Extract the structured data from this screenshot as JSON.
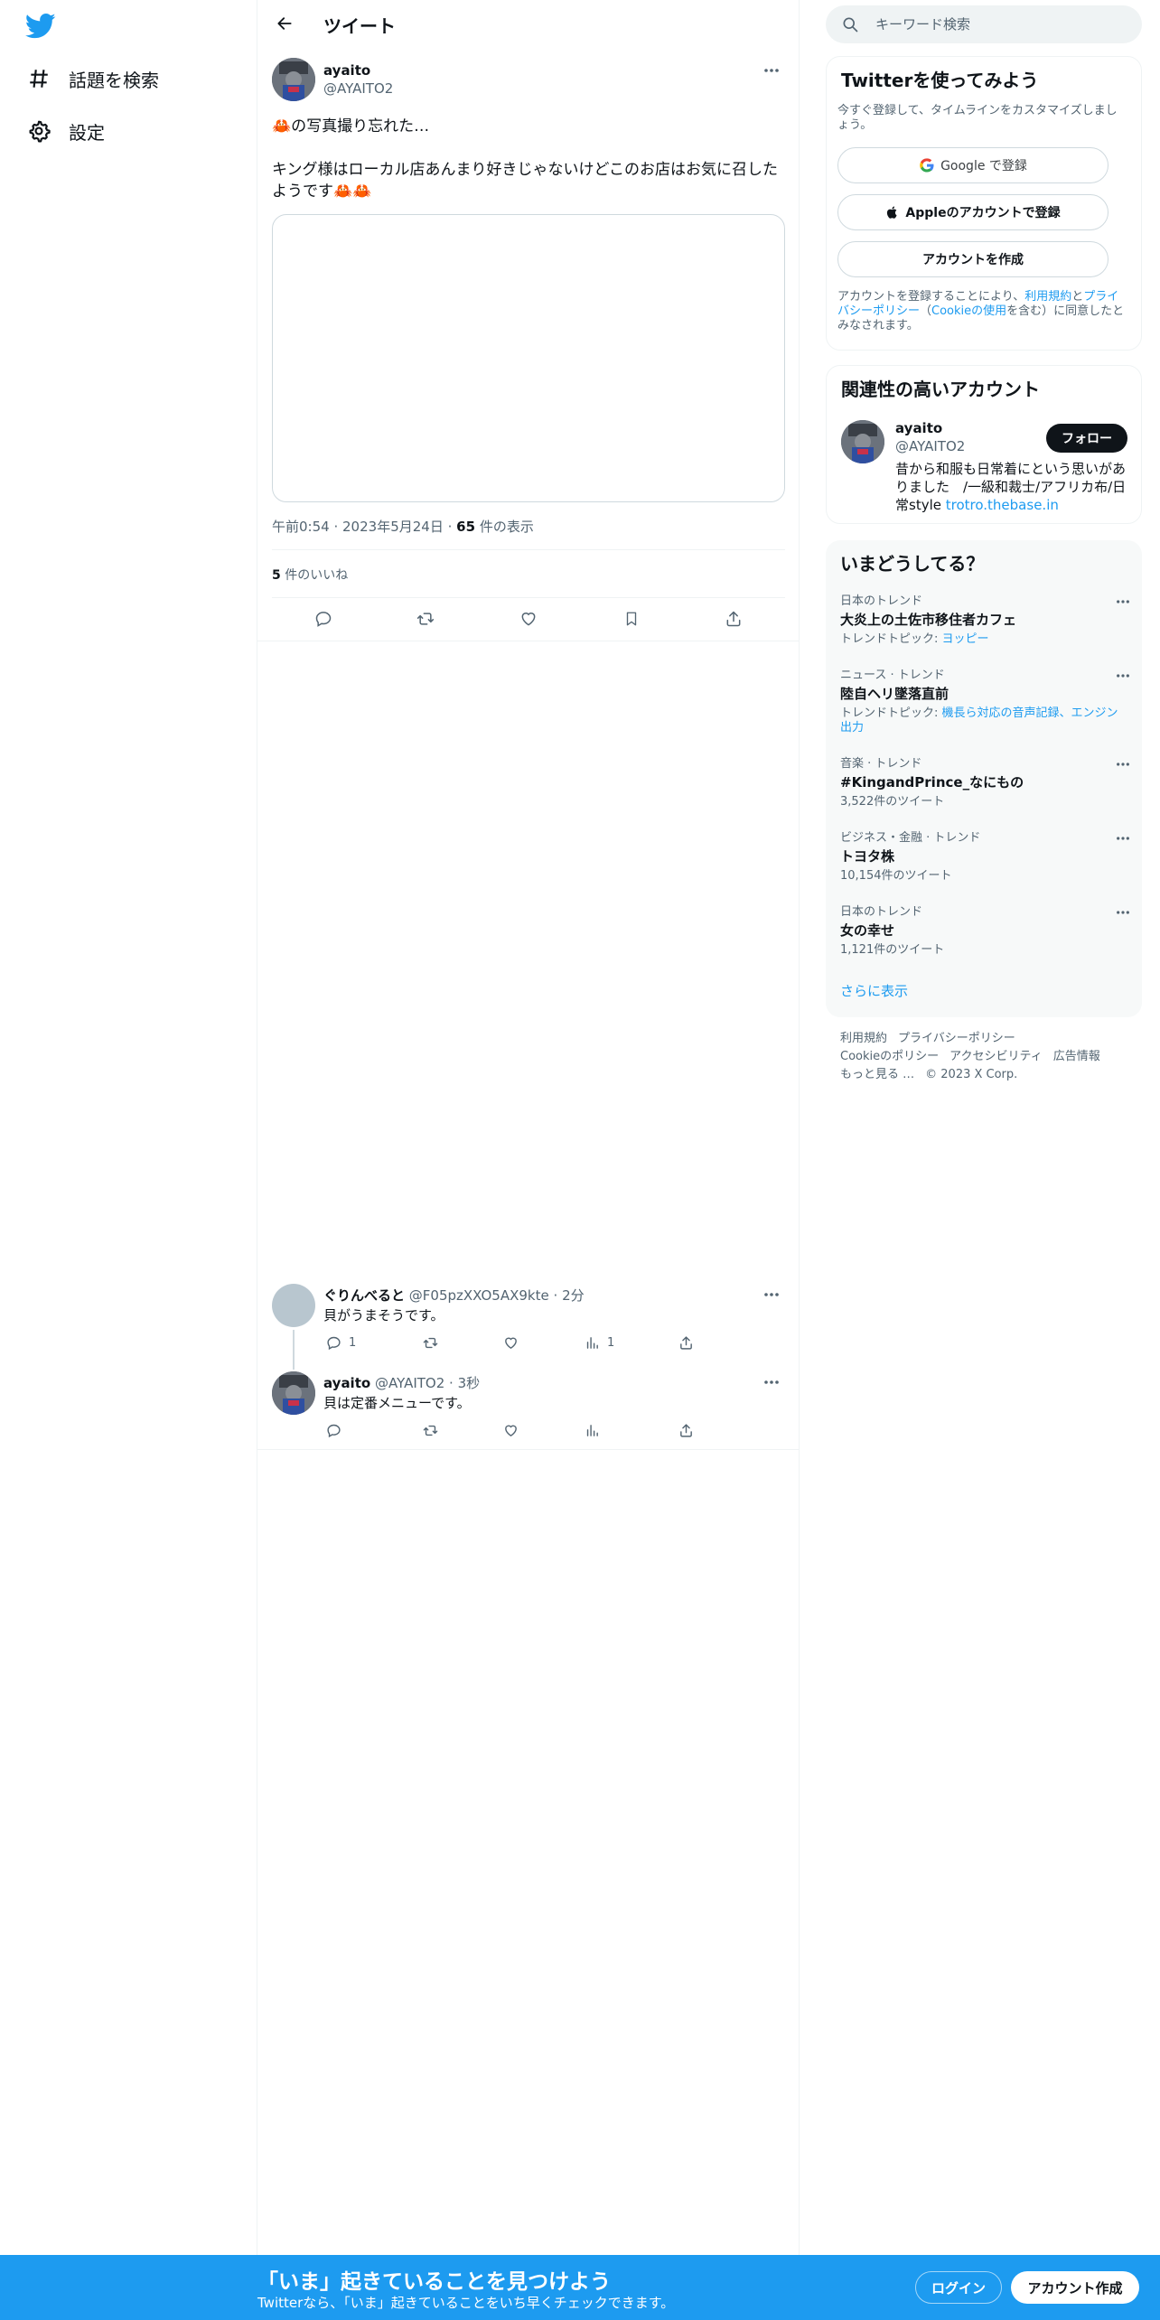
{
  "nav": {
    "items": [
      {
        "label": "話題を検索",
        "icon": "hashtag-icon"
      },
      {
        "label": "設定",
        "icon": "gear-icon"
      }
    ]
  },
  "header": {
    "title": "ツイート"
  },
  "tweet": {
    "author_name": "ayaito",
    "author_handle": "@AYAITO2",
    "text": "🦀の写真撮り忘れた…\n\nキング様はローカル店あんまり好きじゃないけどこのお店はお気に召したようです🦀🦀",
    "time": "午前0:54",
    "date": "2023年5月24日",
    "views_count": "65",
    "views_label": "件の表示",
    "likes_count": "5",
    "likes_label": "件のいいね"
  },
  "replies": [
    {
      "name": "ぐりんべると",
      "handle": "@F05pzXXO5AX9kte",
      "time": "2分",
      "text": "貝がうまそうです。",
      "reply_count": "1",
      "views_count": "1"
    },
    {
      "name": "ayaito",
      "handle": "@AYAITO2",
      "time": "3秒",
      "text": "貝は定番メニューです。",
      "reply_count": "",
      "views_count": ""
    }
  ],
  "search": {
    "placeholder": "キーワード検索"
  },
  "signup": {
    "title": "Twitterを使ってみよう",
    "subtitle": "今すぐ登録して、タイムラインをカスタマイズしましょう。",
    "google_label": "Google で登録",
    "apple_label": "Appleのアカウントで登録",
    "create_label": "アカウントを作成",
    "legal_prefix": "アカウントを登録することにより、",
    "legal_terms": "利用規約",
    "legal_and": "と",
    "legal_privacy": "プライバシーポリシー",
    "legal_paren_open": "（",
    "legal_cookie": "Cookieの使用",
    "legal_suffix": "を含む）に同意したとみなされます。"
  },
  "related": {
    "title": "関連性の高いアカウント",
    "name": "ayaito",
    "handle": "@AYAITO2",
    "follow_label": "フォロー",
    "bio": "昔から和服も日常着にという思いがありました　/一級和裁士/アフリカ布/日常style ",
    "bio_link": "trotro.thebase.in"
  },
  "trends": {
    "title": "いまどうしてる？",
    "items": [
      {
        "context": "日本のトレンド",
        "name": "大炎上の土佐市移住者カフェ",
        "sub_prefix": "トレンドトピック: ",
        "sub_link": "ヨッピー",
        "sub": ""
      },
      {
        "context": "ニュース · トレンド",
        "name": "陸自ヘリ墜落直前",
        "sub_prefix": "トレンドトピック: ",
        "sub_link": "機長ら対応の音声記録、エンジン出力",
        "sub": ""
      },
      {
        "context": "音楽 · トレンド",
        "name": "#KingandPrince_なにもの",
        "sub_prefix": "",
        "sub_link": "",
        "sub": "3,522件のツイート"
      },
      {
        "context": "ビジネス・金融 · トレンド",
        "name": "トヨタ株",
        "sub_prefix": "",
        "sub_link": "",
        "sub": "10,154件のツイート"
      },
      {
        "context": "日本のトレンド",
        "name": "女の幸せ",
        "sub_prefix": "",
        "sub_link": "",
        "sub": "1,121件のツイート"
      }
    ],
    "show_more": "さらに表示"
  },
  "footer": {
    "links": [
      "利用規約",
      "プライバシーポリシー",
      "Cookieのポリシー",
      "アクセシビリティ",
      "広告情報",
      "もっと見る …"
    ],
    "copyright": "© 2023 X Corp."
  },
  "bottom_bar": {
    "title": "「いま」起きていることを見つけよう",
    "subtitle": "Twitterなら、「いま」起きていることをいち早くチェックできます。",
    "login_label": "ログイン",
    "signup_label": "アカウント作成"
  },
  "colors": {
    "accent": "#1d9bf0",
    "text": "#0f1419",
    "secondary": "#536471",
    "border": "#eff3f4"
  }
}
